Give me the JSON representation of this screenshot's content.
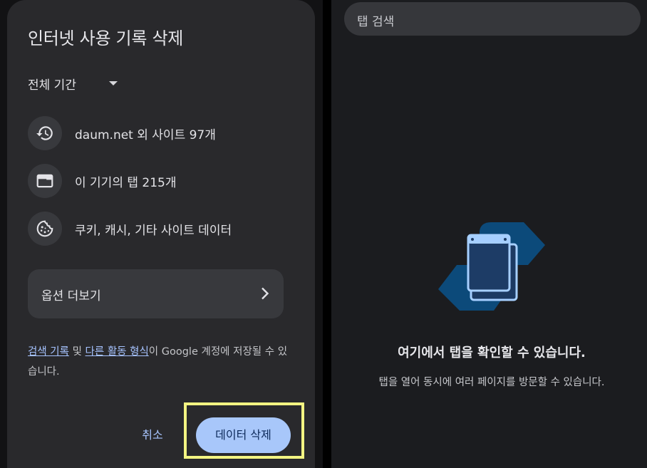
{
  "dialog": {
    "title": "인터넷 사용 기록 삭제",
    "time_range": "전체 기간",
    "items": [
      {
        "icon": "history-icon",
        "label": "daum.net 외 사이트 97개"
      },
      {
        "icon": "tab-icon",
        "label": "이 기기의 탭 215개"
      },
      {
        "icon": "cookie-icon",
        "label": "쿠키, 캐시, 기타 사이트 데이터"
      }
    ],
    "more_options": "옵션 더보기",
    "notice": {
      "link1": "검색 기록",
      "text1": " 및 ",
      "link2": "다른 활동 형식",
      "text2": "이 Google 계정에 저장될 수 있습니다."
    },
    "cancel": "취소",
    "delete": "데이터 삭제"
  },
  "tabs_panel": {
    "search_placeholder": "탭 검색",
    "empty_title": "여기에서 탭을 확인할 수 있습니다.",
    "empty_subtitle": "탭을 열어 동시에 여러 페이지를 방문할 수 있습니다."
  },
  "colors": {
    "accent": "#a8c7fa",
    "highlight_box": "#f3f482",
    "dialog_bg": "#29292c"
  }
}
